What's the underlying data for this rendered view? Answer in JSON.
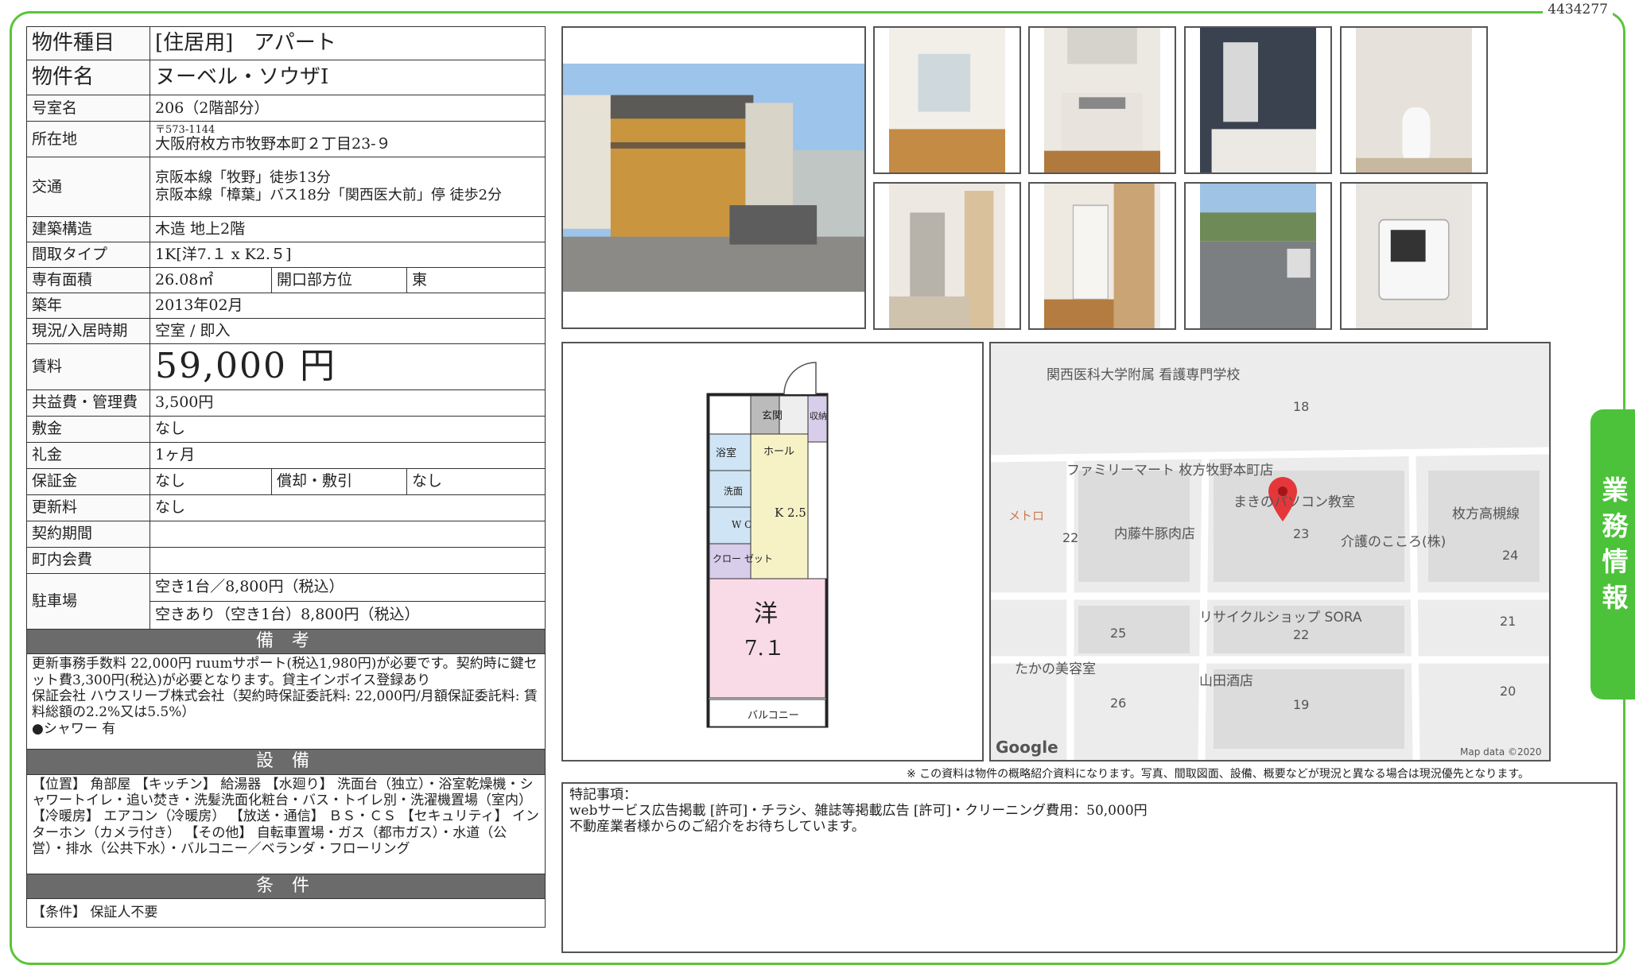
{
  "doc_id": "4434277",
  "side_tab": "業務情報",
  "rows": {
    "type_label": "物件種目",
    "type_value": "[住居用]　アパート",
    "name_label": "物件名",
    "name_value": "ヌーベル・ソウザI",
    "room_label": "号室名",
    "room_value": "206（2階部分）",
    "addr_label": "所在地",
    "addr_zip": "〒573-1144",
    "addr_value": "大阪府枚方市牧野本町２丁目23-９",
    "access_label": "交通",
    "access_1": "京阪本線「牧野」徒歩13分",
    "access_2": "京阪本線「樟葉」バス18分「関西医大前」停  徒歩2分",
    "structure_label": "建築構造",
    "structure_value": "木造 地上2階",
    "layout_label": "間取タイプ",
    "layout_value": "1K[洋7.１ x K2.５]",
    "area_label": "専有面積",
    "area_value": "26.08㎡",
    "direction_label": "開口部方位",
    "direction_value": "東",
    "built_label": "築年",
    "built_value": "2013年02月",
    "status_label": "現況/入居時期",
    "status_value": "空室 / 即入",
    "rent_label": "賃料",
    "rent_value": "59,000 円",
    "fee_label": "共益費・管理費",
    "fee_value": "3,500円",
    "deposit_label": "敷金",
    "deposit_value": "なし",
    "key_label": "礼金",
    "key_value": "1ヶ月",
    "guarantee_label": "保証金",
    "guarantee_value": "なし",
    "refund_label": "償却・敷引",
    "refund_value": "なし",
    "renew_label": "更新料",
    "renew_value": "なし",
    "term_label": "契約期間",
    "term_value": "",
    "town_label": "町内会費",
    "town_value": "",
    "parking_label": "駐車場",
    "parking_1": "空き1台／8,800円（税込）",
    "parking_2": "空きあり（空き1台）8,800円（税込）"
  },
  "sections": {
    "notes_title": "備 考",
    "notes_text": "更新事務手数料 22,000円 ruumサポート(税込1,980円)が必要です。契約時に鍵セット費3,300円(税込)が必要となります。貸主インボイス登録あり\n保証会社 ハウスリーブ株式会社（契約時保証委託料: 22,000円/月額保証委託料: 賃料総額の2.2%又は5.5%）\n●シャワー 有",
    "equip_title": "設 備",
    "equip_text": "【位置】 角部屋 【キッチン】 給湯器 【水廻り】 洗面台（独立）・浴室乾燥機・シャワートイレ・追い焚き・洗髪洗面化粧台・バス・トイレ別・洗濯機置場（室内） 【冷暖房】 エアコン（冷暖房） 【放送・通信】 ＢＳ・ＣＳ 【セキュリティ】 インターホン（カメラ付き） 【その他】 自転車置場・ガス（都市ガス）・水道（公営）・排水（公共下水）・バルコニー／ベランダ・フローリング",
    "cond_title": "条 件",
    "cond_text": "【条件】 保証人不要"
  },
  "floorplan": {
    "genkan": "玄関",
    "shuno": "収納",
    "yokushitsu": "浴室",
    "hall": "ホール",
    "senmen": "洗面",
    "wc": "W C",
    "kitchen": "K\n2.5",
    "closet": "クロー\nゼット",
    "room_name": "洋",
    "room_size": "7.１",
    "balcony": "バルコニー"
  },
  "map": {
    "labels": [
      "関西医科大学附属\n看護専門学校",
      "18",
      "ファミリーマート\n枚方牧野本町店",
      "まきのパソコン教室",
      "枚方高槻線",
      "メトロ",
      "22",
      "内藤牛豚肉店",
      "23",
      "介護のこころ(株)",
      "24",
      "リサイクルショップ SORA",
      "25",
      "22",
      "21",
      "たかの美容室",
      "山田酒店",
      "26",
      "19",
      "20"
    ],
    "google": "Google",
    "credit": "Map data ©2020"
  },
  "disclaimer": "※ この資料は物件の概略紹介資料になります。写真、間取図面、設備、概要などが現況と異なる場合は現況優先となります。",
  "remarks": {
    "title": "特記事項：",
    "line1": "webサービス広告掲載 [許可]・チラシ、雑誌等掲載広告 [許可]・クリーニング費用：50,000円",
    "line2": "不動産業者様からのご紹介をお待ちしています。"
  },
  "colors": {
    "frame": "#5ac53a",
    "side_tab": "#4cc23a",
    "section": "#6b6b6b"
  }
}
